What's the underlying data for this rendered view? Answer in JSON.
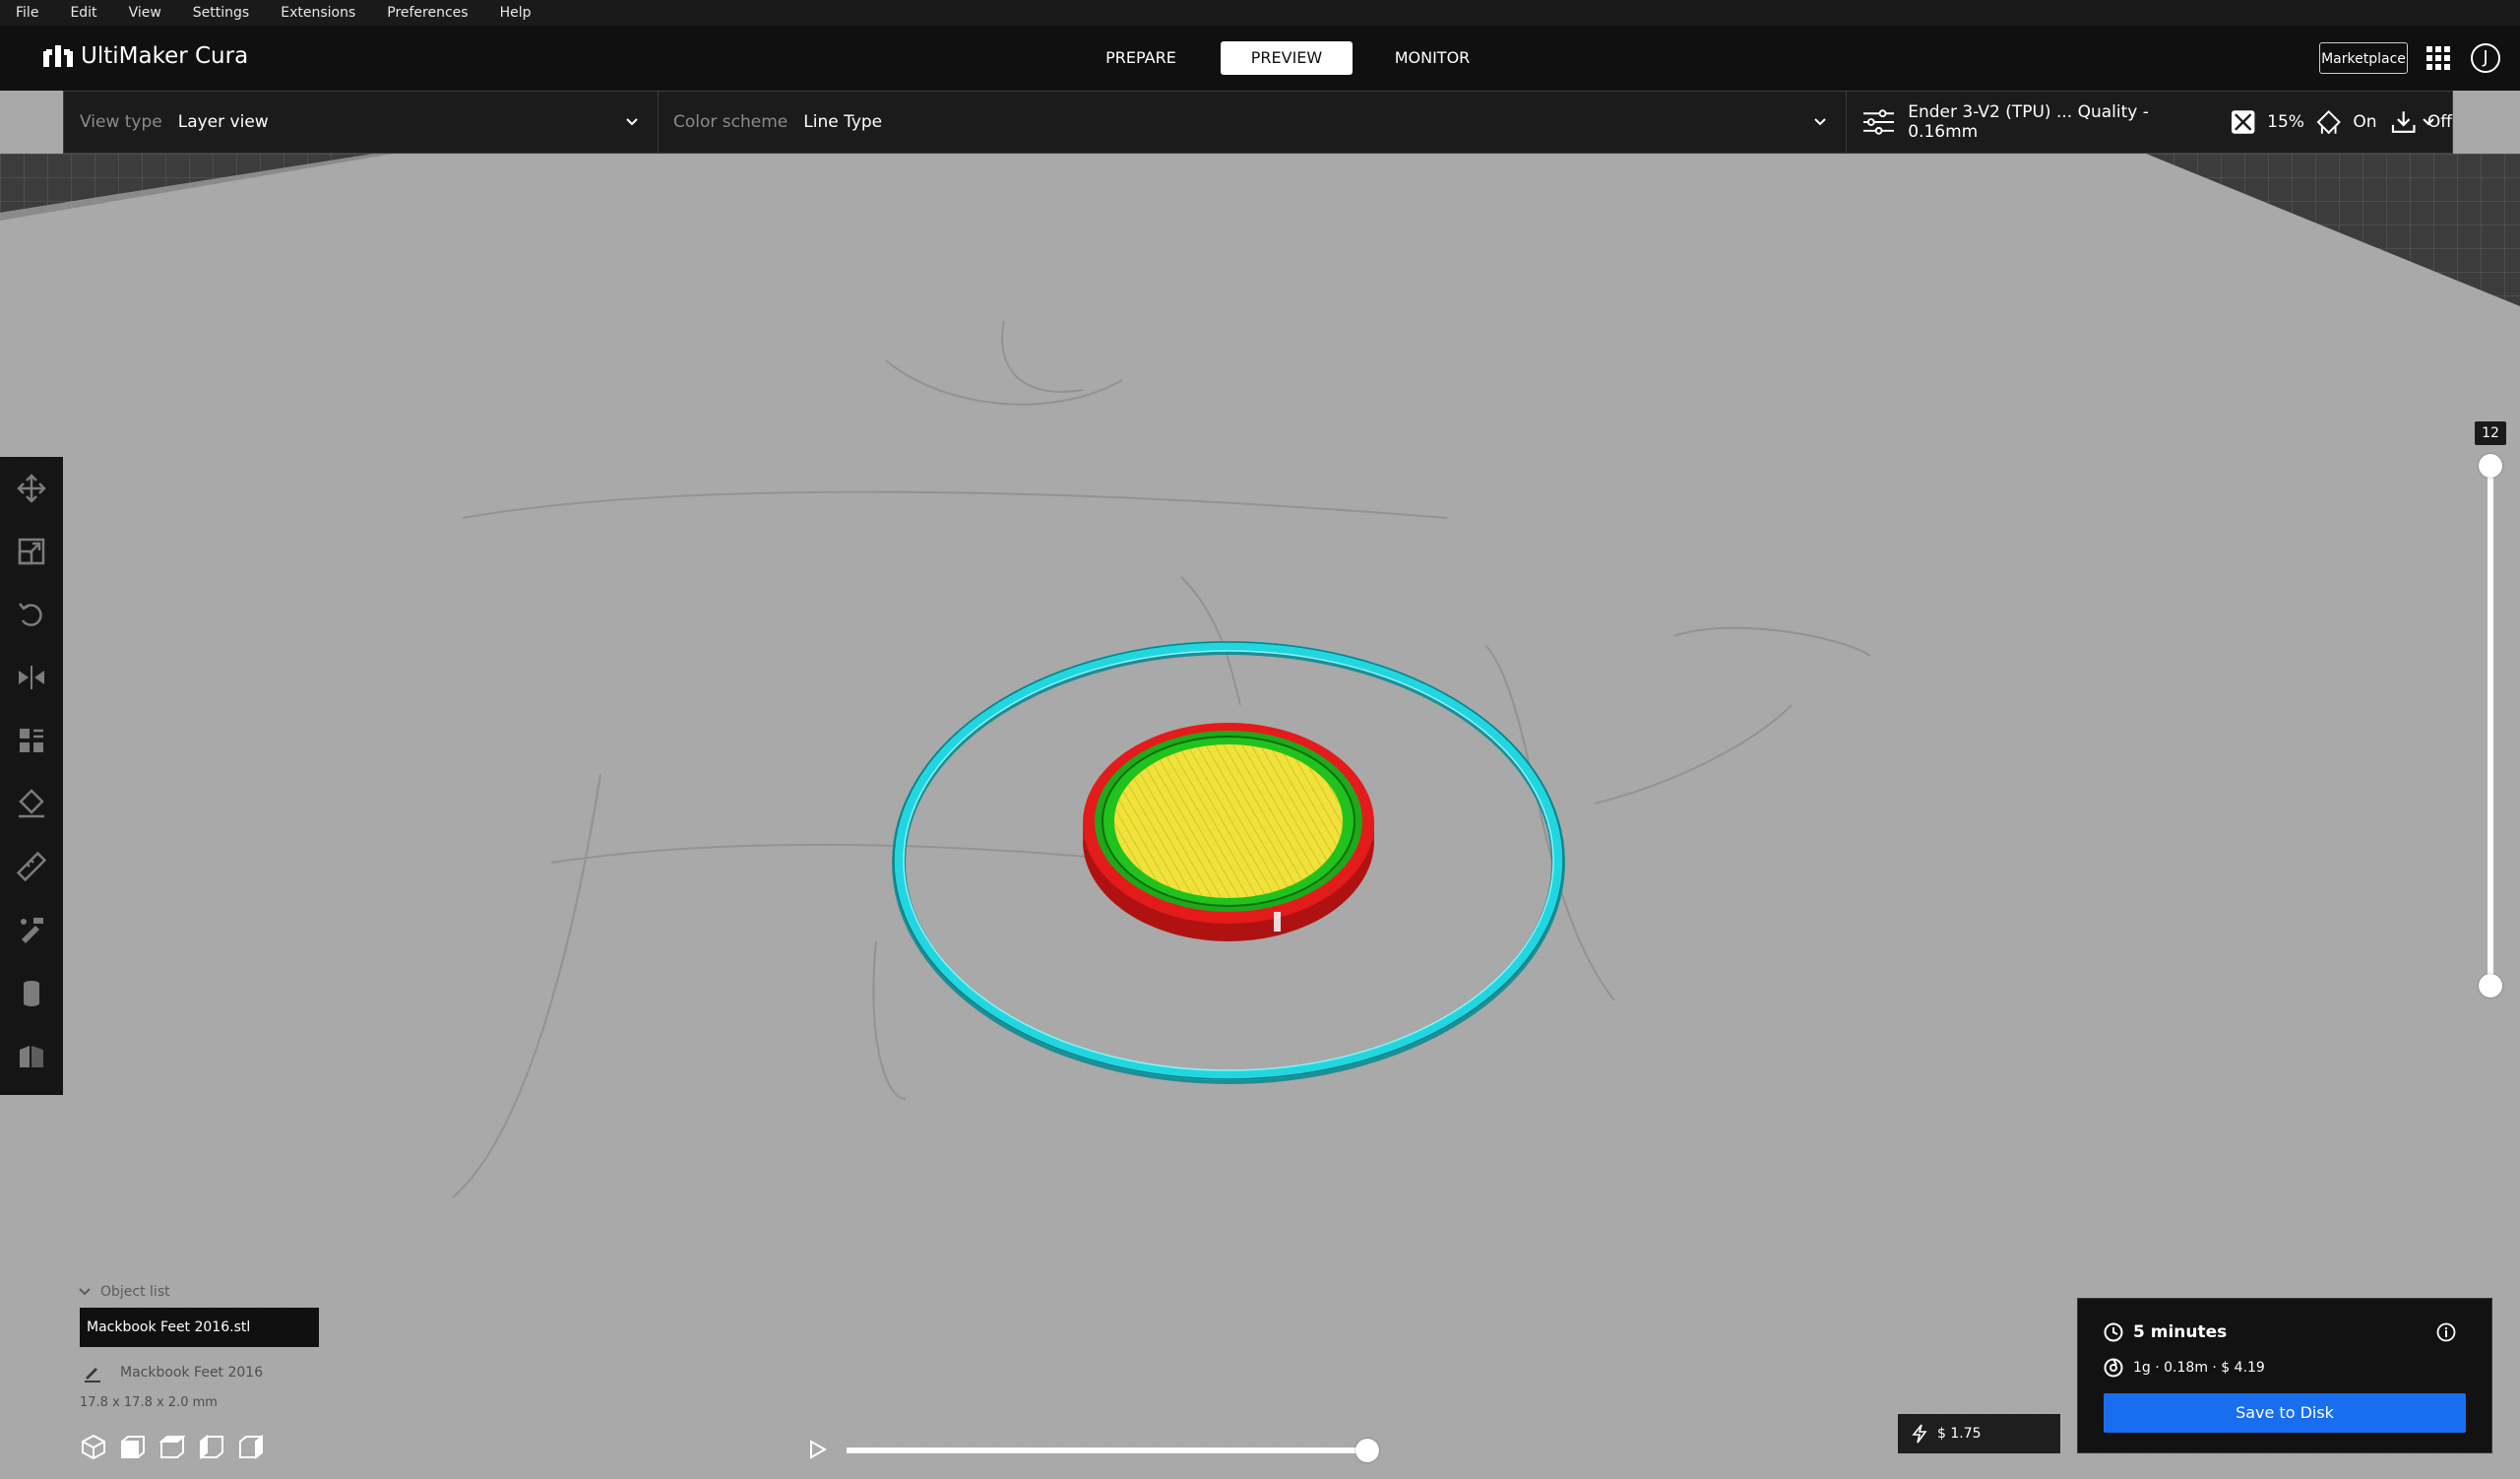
{
  "menu": [
    "File",
    "Edit",
    "View",
    "Settings",
    "Extensions",
    "Preferences",
    "Help"
  ],
  "header": {
    "brand": "UltiMaker Cura",
    "tabs": [
      {
        "label": "PREPARE",
        "active": false
      },
      {
        "label": "PREVIEW",
        "active": true
      },
      {
        "label": "MONITOR",
        "active": false
      }
    ],
    "marketplace": "Marketplace",
    "avatar_initial": "J"
  },
  "toolbar": {
    "view_type_label": "View type",
    "view_type_value": "Layer view",
    "color_scheme_label": "Color scheme",
    "color_scheme_value": "Line Type",
    "printer_profile": "Ender 3-V2 (TPU) ... Quality - 0.16mm",
    "infill": "15%",
    "support": "On",
    "adhesion": "Off"
  },
  "tools": [
    "move-icon",
    "scale-icon",
    "rotate-icon",
    "mirror-icon",
    "per-model-settings-icon",
    "support-blocker-icon",
    "measure-icon",
    "paint-icon",
    "cylinder-icon",
    "tab-anti-warping-icon"
  ],
  "layer_slider": {
    "current_layer": "12",
    "position": 1.0
  },
  "object_list": {
    "toggle": "Object list",
    "file": "Mackbook Feet 2016.stl",
    "name": "Mackbook Feet 2016",
    "dimensions": "17.8 x 17.8 x 2.0 mm"
  },
  "view_cubes": [
    "3d-view-icon",
    "front-view-icon",
    "top-view-icon",
    "left-view-icon",
    "right-view-icon"
  ],
  "simulation": {
    "progress": 1.0
  },
  "cost_box": {
    "value": "$ 1.75"
  },
  "print_panel": {
    "time": "5 minutes",
    "material": "1g · 0.18m · $ 4.19",
    "save_button": "Save to Disk"
  },
  "colors": {
    "accent": "#196ef0",
    "skirt": "#22d6e0",
    "wall_outer": "#e31b1b",
    "wall_inner": "#22c21e",
    "skin": "#f0e23a",
    "buildplate": "#a8a8a8"
  }
}
